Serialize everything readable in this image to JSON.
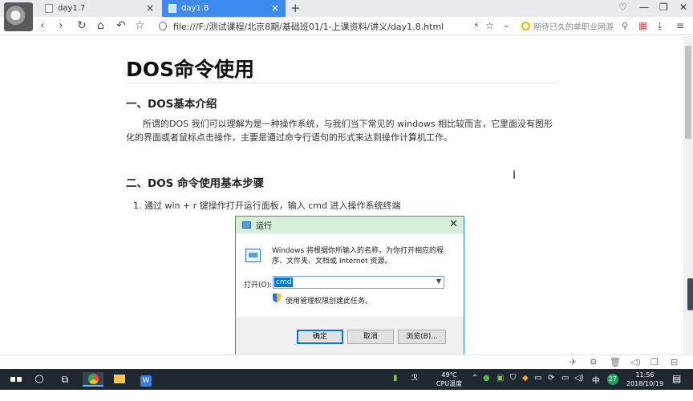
{
  "browser": {
    "tabs": [
      {
        "label": "day1.7",
        "active": false
      },
      {
        "label": "day1.8",
        "active": true
      }
    ],
    "new_tab_symbol": "+",
    "url": "file:///F:/测试课程/北京8期/基础班01/1-上课资料/讲义/day1.8.html",
    "search_placeholder": "期待已久的单职业网游",
    "window_controls": [
      "minimize",
      "maximize",
      "close"
    ]
  },
  "document": {
    "title": "DOS命令使用",
    "section1": {
      "heading": "一、DOS基本介绍",
      "paragraph": "所谓的DOS 我们可以理解为是一种操作系统，与我们当下常见的 windows 相比较而言，它里面没有图形化的界面或者鼠标点击操作，主要是通过命令行语句的形式来达到操作计算机工作。"
    },
    "section2": {
      "heading": "二、DOS 命令使用基本步骤",
      "step1": "1. 通过 win + r 键操作打开运行面板，输入 cmd 进入操作系统终端"
    }
  },
  "run_dialog": {
    "title": "运行",
    "close": "✕",
    "description": "Windows 将根据你所输入的名称，为你打开相应的程序、文件夹、文档或 Internet 资源。",
    "open_label": "打开(O):",
    "input_value": "cmd",
    "admin_note": "使用管理权限创建此任务。",
    "ok": "确定",
    "cancel": "取消",
    "browse": "浏览(B)..."
  },
  "taskbar": {
    "temperature": "49℃",
    "temp_label": "CPU温度",
    "ime": "中",
    "time": "11:56",
    "date": "2018/10/19",
    "badge_count": "27",
    "colors": {
      "taskbar": "#1f2730",
      "active_tab": "#3d8bf0",
      "dialog_title": "#d6efd9"
    }
  }
}
